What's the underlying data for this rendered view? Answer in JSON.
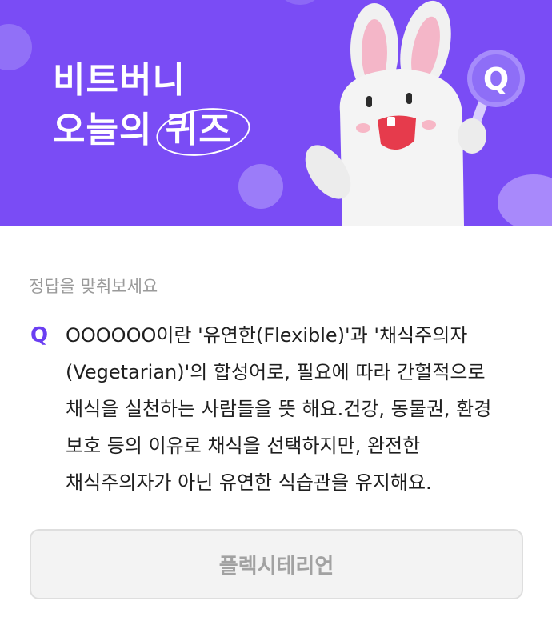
{
  "hero": {
    "title_line1": "비트버니",
    "title_line2_prefix": "오늘의",
    "title_line2_highlight": "퀴즈",
    "badge_letter": "Q"
  },
  "quiz": {
    "instruction": "정답을 맞춰보세요",
    "q_mark": "Q",
    "question": "OOOOOO이란 '유연한(Flexible)'과 '채식주의자(Vegetarian)'의 합성어로, 필요에 따라 간헐적으로 채식을 실천하는 사람들을 뜻 해요.건강, 동물권, 환경 보호 등의 이유로 채식을 선택하지만, 완전한 채식주의자가 아닌 유연한 식습관을 유지해요.",
    "answer": "플렉시테리언"
  },
  "colors": {
    "brand_purple": "#7a4cf5",
    "accent_purple": "#6a3ef2"
  }
}
